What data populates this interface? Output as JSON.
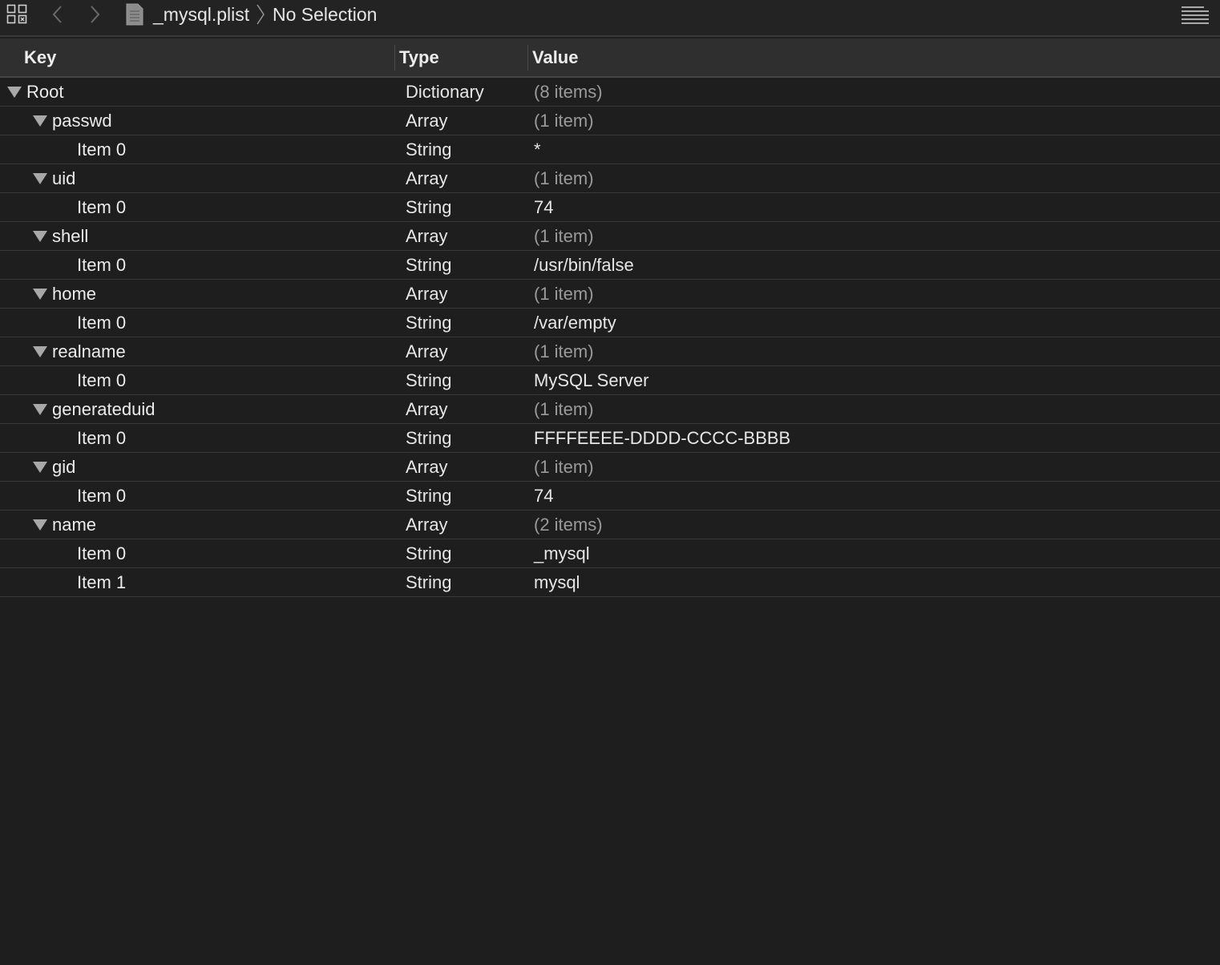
{
  "jumpbar": {
    "file_name": "_mysql.plist",
    "selection": "No Selection",
    "icons": {
      "grid": "related-items-grid-icon",
      "back": "chevron-left-icon",
      "forward": "chevron-right-icon",
      "file": "plist-file-icon",
      "separator": "breadcrumb-chevron-icon",
      "menu": "lines-menu-icon"
    }
  },
  "columns": {
    "key": "Key",
    "type": "Type",
    "value": "Value"
  },
  "rows": [
    {
      "key": "Root",
      "type": "Dictionary",
      "value": "(8 items)",
      "level": 0,
      "expandable": true,
      "muted": true
    },
    {
      "key": "passwd",
      "type": "Array",
      "value": "(1 item)",
      "level": 1,
      "expandable": true,
      "muted": true
    },
    {
      "key": "Item 0",
      "type": "String",
      "value": "*",
      "level": 2,
      "expandable": false,
      "muted": false
    },
    {
      "key": "uid",
      "type": "Array",
      "value": "(1 item)",
      "level": 1,
      "expandable": true,
      "muted": true
    },
    {
      "key": "Item 0",
      "type": "String",
      "value": "74",
      "level": 2,
      "expandable": false,
      "muted": false
    },
    {
      "key": "shell",
      "type": "Array",
      "value": "(1 item)",
      "level": 1,
      "expandable": true,
      "muted": true
    },
    {
      "key": "Item 0",
      "type": "String",
      "value": "/usr/bin/false",
      "level": 2,
      "expandable": false,
      "muted": false
    },
    {
      "key": "home",
      "type": "Array",
      "value": "(1 item)",
      "level": 1,
      "expandable": true,
      "muted": true
    },
    {
      "key": "Item 0",
      "type": "String",
      "value": "/var/empty",
      "level": 2,
      "expandable": false,
      "muted": false
    },
    {
      "key": "realname",
      "type": "Array",
      "value": "(1 item)",
      "level": 1,
      "expandable": true,
      "muted": true
    },
    {
      "key": "Item 0",
      "type": "String",
      "value": "MySQL Server",
      "level": 2,
      "expandable": false,
      "muted": false
    },
    {
      "key": "generateduid",
      "type": "Array",
      "value": "(1 item)",
      "level": 1,
      "expandable": true,
      "muted": true
    },
    {
      "key": "Item 0",
      "type": "String",
      "value": "FFFFEEEE-DDDD-CCCC-BBBB",
      "level": 2,
      "expandable": false,
      "muted": false
    },
    {
      "key": "gid",
      "type": "Array",
      "value": "(1 item)",
      "level": 1,
      "expandable": true,
      "muted": true
    },
    {
      "key": "Item 0",
      "type": "String",
      "value": "74",
      "level": 2,
      "expandable": false,
      "muted": false
    },
    {
      "key": "name",
      "type": "Array",
      "value": "(2 items)",
      "level": 1,
      "expandable": true,
      "muted": true
    },
    {
      "key": "Item 0",
      "type": "String",
      "value": "_mysql",
      "level": 2,
      "expandable": false,
      "muted": false
    },
    {
      "key": "Item 1",
      "type": "String",
      "value": "mysql",
      "level": 2,
      "expandable": false,
      "muted": false
    }
  ],
  "colors": {
    "background": "#1e1e1e",
    "header": "#2f2f2f",
    "text": "#e8e8e8",
    "muted_text": "#9a9a9a",
    "disclosure": "#a8a8a8"
  }
}
